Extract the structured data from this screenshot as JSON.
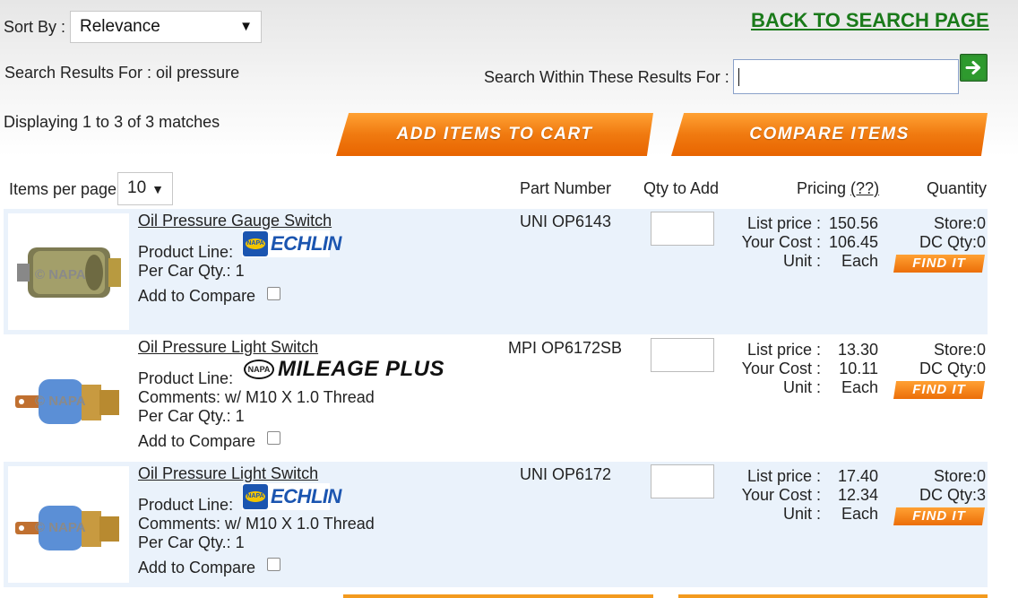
{
  "controls": {
    "sort_label": "Sort By :",
    "sort_value": "Relevance",
    "back_link": "BACK TO SEARCH PAGE",
    "search_results_label": "Search Results For : oil pressure",
    "within_label": "Search Within These Results For :",
    "within_value": "",
    "displaying": "Displaying 1 to 3 of 3 matches",
    "add_to_cart": "ADD ITEMS TO CART",
    "compare": "COMPARE ITEMS",
    "items_per_page_label": "Items per page",
    "items_per_page_value": "10"
  },
  "columns": {
    "part_number": "Part Number",
    "qty_to_add": "Qty to Add",
    "pricing": "Pricing",
    "pricing_help": "(??)",
    "quantity": "Quantity"
  },
  "products": [
    {
      "name": "Oil Pressure Gauge Switch",
      "product_line_label": "Product Line:",
      "brand": "ECHLIN",
      "comments": "",
      "per_car": "Per Car Qty.: 1",
      "compare_label": "Add to Compare",
      "part_number": "UNI OP6143",
      "list_label": "List price :",
      "list_price": "150.56",
      "cost_label": "Your Cost :",
      "your_cost": "106.45",
      "unit_label": "Unit :",
      "unit": "Each",
      "store": "Store:0",
      "dc": "DC Qty:0",
      "find_it": "FIND IT",
      "watermark": "© NAPA"
    },
    {
      "name": "Oil Pressure Light Switch",
      "product_line_label": "Product Line:",
      "brand": "MILEAGE PLUS",
      "comments": "Comments: w/ M10 X 1.0 Thread",
      "per_car": "Per Car Qty.: 1",
      "compare_label": "Add to Compare",
      "part_number": "MPI OP6172SB",
      "list_label": "List price :",
      "list_price": "13.30",
      "cost_label": "Your Cost :",
      "your_cost": "10.11",
      "unit_label": "Unit :",
      "unit": "Each",
      "store": "Store:0",
      "dc": "DC Qty:0",
      "find_it": "FIND IT",
      "watermark": "© NAPA"
    },
    {
      "name": "Oil Pressure Light Switch",
      "product_line_label": "Product Line:",
      "brand": "ECHLIN",
      "comments": "Comments: w/ M10 X 1.0 Thread",
      "per_car": "Per Car Qty.: 1",
      "compare_label": "Add to Compare",
      "part_number": "UNI OP6172",
      "list_label": "List price :",
      "list_price": "17.40",
      "cost_label": "Your Cost :",
      "your_cost": "12.34",
      "unit_label": "Unit :",
      "unit": "Each",
      "store": "Store:0",
      "dc": "DC Qty:3",
      "find_it": "FIND IT",
      "watermark": "© NAPA"
    }
  ],
  "colors": {
    "accent_orange": "#f07a10",
    "link_green": "#1a7a1a",
    "row_shade": "#eaf2fb",
    "napa_blue": "#1b55b0"
  }
}
